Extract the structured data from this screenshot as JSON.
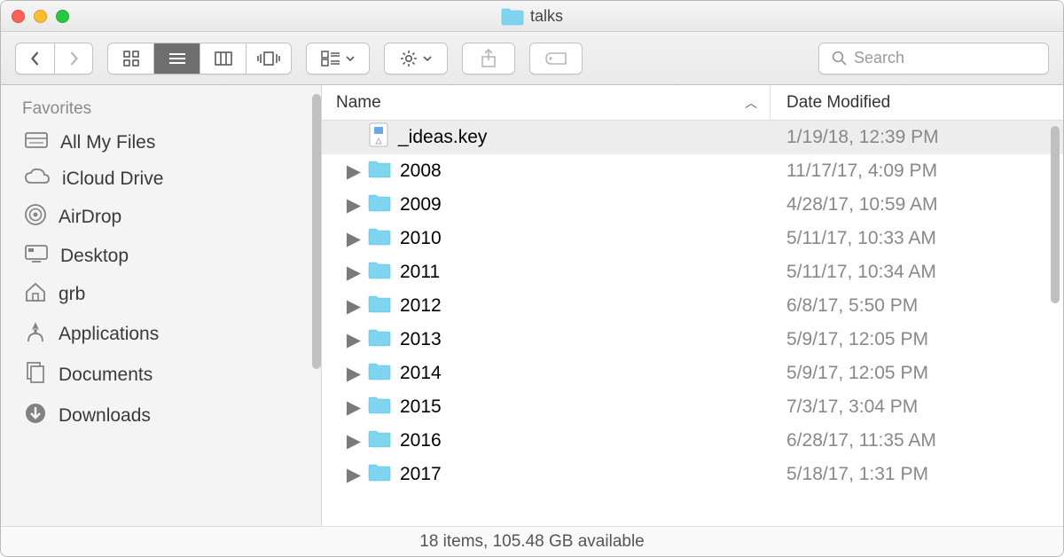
{
  "window": {
    "title": "talks"
  },
  "toolbar": {
    "search_placeholder": "Search"
  },
  "sidebar": {
    "heading": "Favorites",
    "items": [
      {
        "icon": "all-files",
        "label": "All My Files"
      },
      {
        "icon": "icloud",
        "label": "iCloud Drive"
      },
      {
        "icon": "airdrop",
        "label": "AirDrop"
      },
      {
        "icon": "desktop",
        "label": "Desktop"
      },
      {
        "icon": "house",
        "label": "grb"
      },
      {
        "icon": "apps",
        "label": "Applications"
      },
      {
        "icon": "documents",
        "label": "Documents"
      },
      {
        "icon": "downloads",
        "label": "Downloads"
      }
    ]
  },
  "columns": {
    "name": "Name",
    "date": "Date Modified"
  },
  "files": [
    {
      "type": "file",
      "name": "_ideas.key",
      "date": "1/19/18, 12:39 PM",
      "selected": true
    },
    {
      "type": "folder",
      "name": "2008",
      "date": "11/17/17, 4:09 PM"
    },
    {
      "type": "folder",
      "name": "2009",
      "date": "4/28/17, 10:59 AM"
    },
    {
      "type": "folder",
      "name": "2010",
      "date": "5/11/17, 10:33 AM"
    },
    {
      "type": "folder",
      "name": "2011",
      "date": "5/11/17, 10:34 AM"
    },
    {
      "type": "folder",
      "name": "2012",
      "date": "6/8/17, 5:50 PM"
    },
    {
      "type": "folder",
      "name": "2013",
      "date": "5/9/17, 12:05 PM"
    },
    {
      "type": "folder",
      "name": "2014",
      "date": "5/9/17, 12:05 PM"
    },
    {
      "type": "folder",
      "name": "2015",
      "date": "7/3/17, 3:04 PM"
    },
    {
      "type": "folder",
      "name": "2016",
      "date": "6/28/17, 11:35 AM"
    },
    {
      "type": "folder",
      "name": "2017",
      "date": "5/18/17, 1:31 PM"
    }
  ],
  "status": "18 items, 105.48 GB available"
}
